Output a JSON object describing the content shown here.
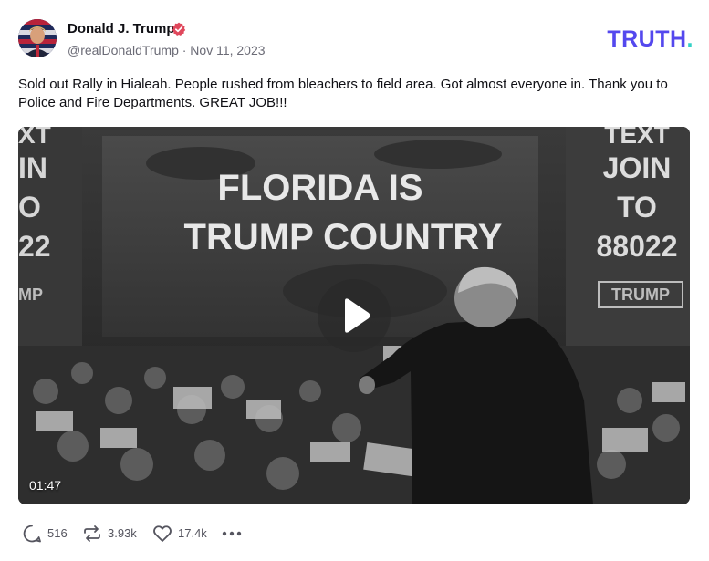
{
  "post": {
    "author": {
      "display_name": "Donald J. Trump",
      "verified": true,
      "meta": "@realDonaldTrump · Nov 11, 2023"
    },
    "brand": {
      "name": "TRUTH",
      "dot": "."
    },
    "text": "Sold out Rally in Hialeah. People rushed from bleachers to field area. Got almost everyone in. Thank you to Police and Fire Departments. GREAT JOB!!!",
    "media": {
      "type": "video",
      "duration": "01:47",
      "screen_headline_line1": "FLORIDA IS",
      "screen_headline_line2": "TRUMP COUNTRY",
      "right_screen_lines": [
        "TEXT",
        "JOIN",
        "TO",
        "88022",
        "TRUMP"
      ],
      "left_screen_lines": [
        "XT",
        "IN",
        "O",
        "22",
        "MP"
      ]
    },
    "actions": {
      "replies": "516",
      "retruths": "3.93k",
      "likes": "17.4k"
    },
    "icons": {
      "verified": "verified-badge-icon",
      "play": "play-icon",
      "reply": "reply-icon",
      "retruth": "retruth-icon",
      "like": "heart-icon",
      "more": "more-options-icon"
    },
    "colors": {
      "brand_primary": "#5448ee",
      "brand_accent": "#33d1c6",
      "verified": "#e0485c",
      "text_secondary": "#6b6b76"
    }
  }
}
